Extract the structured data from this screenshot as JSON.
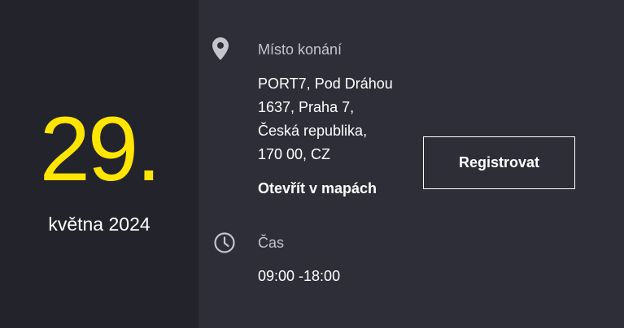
{
  "event_date": {
    "day": "29.",
    "month_year": "května 2024"
  },
  "venue": {
    "icon": "location-pin-icon",
    "label": "Místo konání",
    "address_lines": [
      "PORT7, Pod Dráhou",
      "1637, Praha 7,",
      "Česká republika,",
      "170 00, CZ"
    ],
    "map_link": "Otevřít v mapách"
  },
  "time": {
    "icon": "clock-icon",
    "label": "Čas",
    "value": "09:00 -18:00"
  },
  "register_button": {
    "label": "Registrovat"
  },
  "colors": {
    "date_panel_bg": "#23232b",
    "info_panel_bg": "#2e2e38",
    "accent_yellow": "#ffe600",
    "label_gray": "#c4c4cd",
    "text_white": "#ffffff"
  }
}
